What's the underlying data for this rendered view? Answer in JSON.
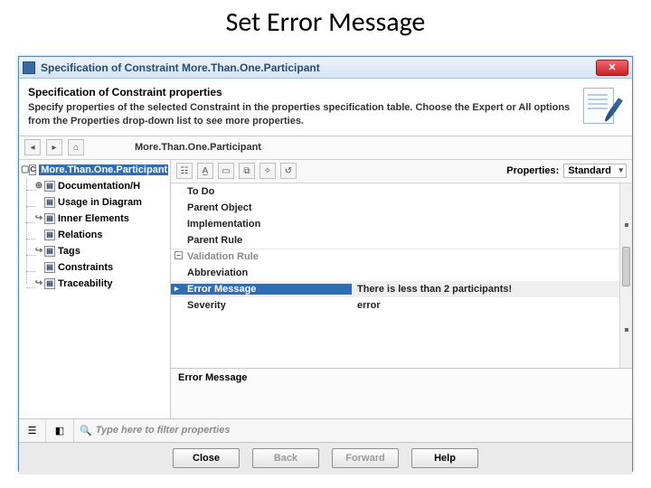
{
  "slide": {
    "title": "Set Error Message"
  },
  "dialog": {
    "title": "Specification of Constraint More.Than.One.Participant",
    "header": {
      "title": "Specification of Constraint properties",
      "subtitle": "Specify properties of the selected Constraint in the properties specification table. Choose the Expert or All options from the Properties drop-down list to see more properties."
    },
    "breadcrumb": "More.Than.One.Participant",
    "tree": {
      "root": "More.Than.One.Participant",
      "items": [
        "Documentation/H",
        "Usage in Diagram",
        "Inner Elements",
        "Relations",
        "Tags",
        "Constraints",
        "Traceability"
      ]
    },
    "properties_label": "Properties:",
    "properties_mode": "Standard",
    "grid": {
      "rows": [
        {
          "k": "To Do",
          "v": ""
        },
        {
          "k": "Parent Object",
          "v": ""
        },
        {
          "k": "Implementation",
          "v": ""
        },
        {
          "k": "Parent Rule",
          "v": ""
        }
      ],
      "group": "Validation Rule",
      "vrows": [
        {
          "k": "Abbreviation",
          "v": ""
        },
        {
          "k": "Error Message",
          "v": "There is less than 2 participants!"
        },
        {
          "k": "Severity",
          "v": "error"
        }
      ]
    },
    "description_title": "Error Message",
    "filter_placeholder": "Type here to filter properties",
    "buttons": {
      "close": "Close",
      "back": "Back",
      "forward": "Forward",
      "help": "Help"
    }
  }
}
